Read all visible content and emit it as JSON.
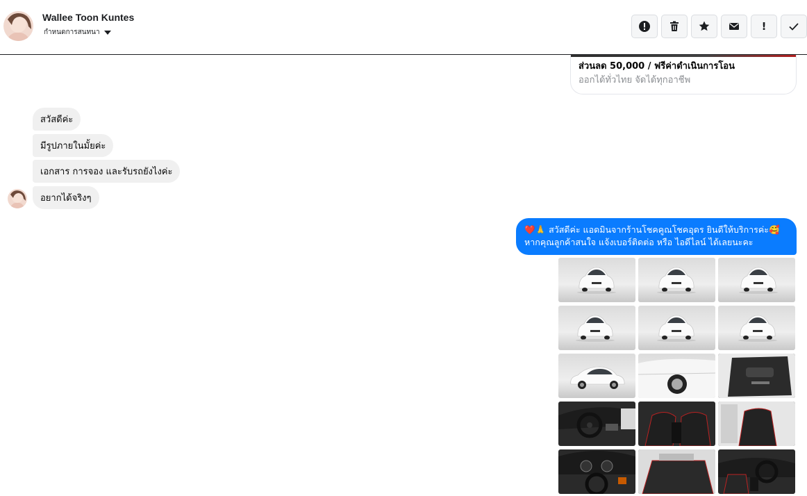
{
  "header": {
    "name": "Wallee Toon Kuntes",
    "subtitle": "กำหนดการสนทนา",
    "actions": [
      {
        "icon": "alert-circle-icon",
        "text": ""
      },
      {
        "icon": "trash-icon",
        "text": ""
      },
      {
        "icon": "star-icon",
        "text": ""
      },
      {
        "icon": "mail-icon",
        "text": ""
      },
      {
        "icon": "exclamation-icon",
        "text": "!"
      },
      {
        "icon": "check-icon",
        "text": ""
      }
    ]
  },
  "previous_card": {
    "title": "ส่วนลด 50,000 / ฟรีค่าดำเนินการโอน",
    "subtitle": "ออกได้ทั่วไทย จัดได้ทุกอาชีพ"
  },
  "incoming_messages": [
    "สวัสดีค่ะ",
    "มีรูปภายในมั้ยค่ะ",
    "เอกสาร การจอง และรับรถยังไงค่ะ",
    "อยากได้จริงๆ"
  ],
  "outgoing_message": {
    "line1": "❤️🙏 สวัสดีค่ะ แอดมินจากร้านโชคคูณโชคอุดร ยินดีให้บริการค่ะ🥰",
    "line2": "หากคุณลูกค้าสนใจ แจ้งเบอร์ติดต่อ หรือ ไอดีไลน์ ได้เลยนะคะ"
  },
  "photos": [
    {
      "kind": "ext-front-left"
    },
    {
      "kind": "ext-front"
    },
    {
      "kind": "ext-front-right"
    },
    {
      "kind": "ext-rear-left"
    },
    {
      "kind": "ext-rear"
    },
    {
      "kind": "ext-rear-right"
    },
    {
      "kind": "ext-side"
    },
    {
      "kind": "ext-wheel"
    },
    {
      "kind": "int-door"
    },
    {
      "kind": "int-dash"
    },
    {
      "kind": "int-seats"
    },
    {
      "kind": "int-seat-side"
    },
    {
      "kind": "int-cluster"
    },
    {
      "kind": "int-rear-seat"
    },
    {
      "kind": "int-cabin"
    }
  ],
  "colors": {
    "accent": "#0a7cff",
    "incoming_bubble": "#f0f0f0"
  }
}
